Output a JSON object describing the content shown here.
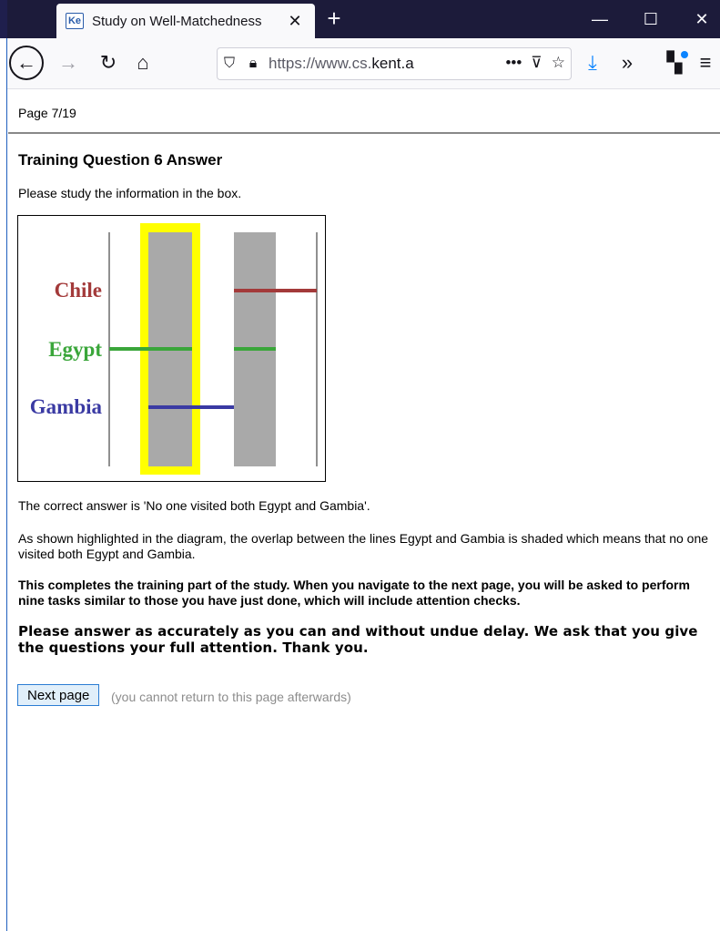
{
  "browser": {
    "tab_title": "Study on Well-Matchedness",
    "favicon_text": "Ke",
    "url_scheme": "https://www.cs.",
    "url_host": "kent.a",
    "accent": "#0a84ff",
    "titlebar_color": "#1c1b3a"
  },
  "page": {
    "page_number": "Page 7/19",
    "heading": "Training Question 6 Answer",
    "instruction": "Please study the information in the box.",
    "answer": "The correct answer is 'No one visited both Egypt and Gambia'.",
    "explanation": "As shown highlighted in the diagram, the overlap between the lines Egypt and Gambia is shaded which means that no one visited both Egypt and Gambia.",
    "completion": "This completes the training part of the study. When you navigate to the next page, you will be asked to perform nine tasks similar to those you have just done, which will include attention checks.",
    "request": "Please answer as accurately as you can and without undue delay. We ask that you give the questions your full attention. Thank you.",
    "next_button": "Next page",
    "next_note": "(you cannot return to this page afterwards)"
  },
  "diagram": {
    "labels": [
      {
        "text": "Chile",
        "color": "#a33a3a"
      },
      {
        "text": "Egypt",
        "color": "#3aa63a"
      },
      {
        "text": "Gambia",
        "color": "#3a3aa3"
      }
    ],
    "highlight_color": "#ffff00",
    "shade_color": "#a9a9a9"
  }
}
